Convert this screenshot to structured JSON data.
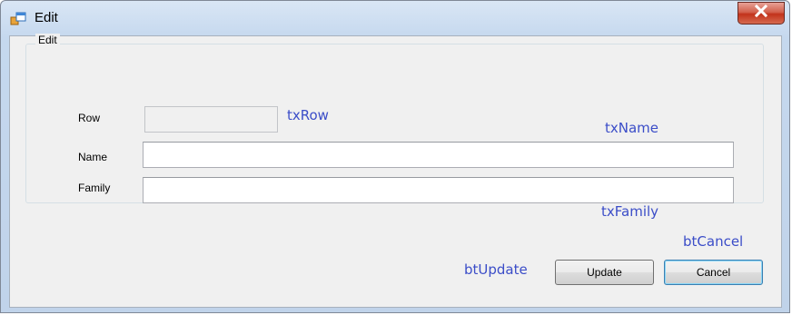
{
  "window": {
    "title": "Edit",
    "icon": "windows-form-icon",
    "close_icon": "close-x-icon"
  },
  "group": {
    "label": "Edit"
  },
  "fields": {
    "row": {
      "label": "Row",
      "value": "",
      "enabled": false
    },
    "name": {
      "label": "Name",
      "value": ""
    },
    "family": {
      "label": "Family",
      "value": ""
    }
  },
  "annotations": {
    "txRow": "txRow",
    "txName": "txName",
    "txFamily": "txFamily",
    "btCancel": "btCancel",
    "btUpdate": "btUpdate"
  },
  "buttons": {
    "update": "Update",
    "cancel": "Cancel"
  },
  "colors": {
    "annotation": "#3b4dc8",
    "close_button": "#c2321b"
  }
}
